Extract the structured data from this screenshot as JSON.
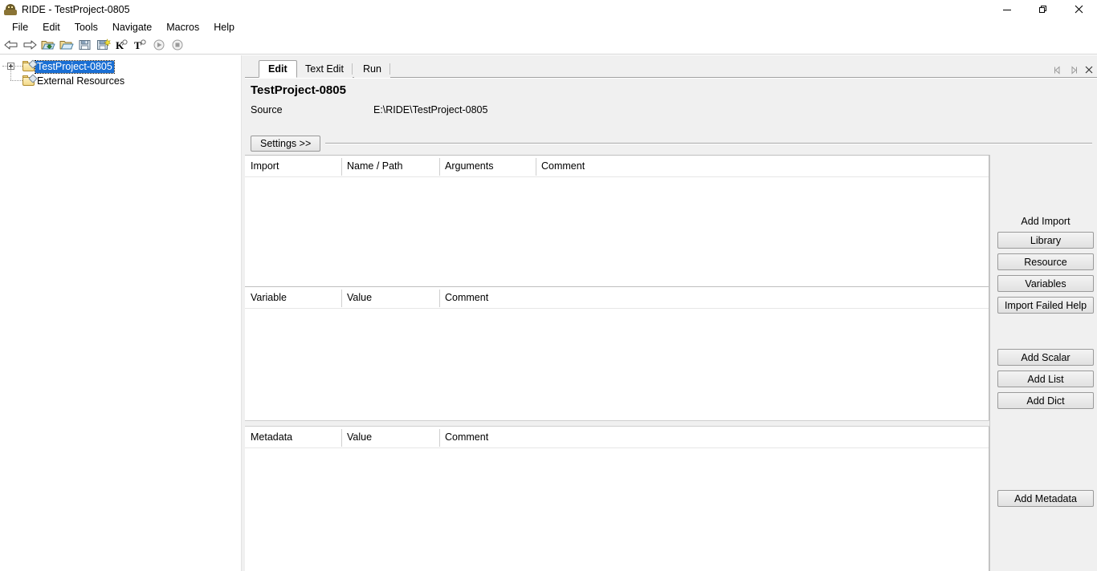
{
  "window": {
    "title": "RIDE - TestProject-0805",
    "app_icon": "robot-icon",
    "controls": [
      {
        "name": "minimize-button",
        "glyph": "minimize-icon"
      },
      {
        "name": "restore-button",
        "glyph": "restore-icon"
      },
      {
        "name": "close-button",
        "glyph": "close-icon"
      }
    ]
  },
  "menubar": {
    "items": [
      {
        "label": "File"
      },
      {
        "label": "Edit"
      },
      {
        "label": "Tools"
      },
      {
        "label": "Navigate"
      },
      {
        "label": "Macros"
      },
      {
        "label": "Help"
      }
    ]
  },
  "toolbar": {
    "items": [
      {
        "name": "back-arrow-icon",
        "title": "Back"
      },
      {
        "name": "forward-arrow-icon",
        "title": "Forward"
      },
      {
        "name": "open-directory-icon",
        "title": "Open Directory"
      },
      {
        "name": "open-file-icon",
        "title": "Open"
      },
      {
        "name": "save-icon",
        "title": "Save"
      },
      {
        "name": "save-all-icon",
        "title": "Save All"
      },
      {
        "name": "search-keyword-icon",
        "title": "Search Keywords",
        "letter": "K"
      },
      {
        "name": "search-tests-icon",
        "title": "Search Tests",
        "letter": "T"
      },
      {
        "name": "run-icon",
        "title": "Run"
      },
      {
        "name": "stop-icon",
        "title": "Stop"
      }
    ]
  },
  "tree": {
    "items": [
      {
        "label": "TestProject-0805",
        "selected": true,
        "expandable": true,
        "icon": "project-folder-icon"
      },
      {
        "label": "External Resources",
        "selected": false,
        "expandable": false,
        "icon": "folder-icon"
      }
    ]
  },
  "tabs": {
    "items": [
      {
        "label": "Edit",
        "active": true
      },
      {
        "label": "Text Edit",
        "active": false
      },
      {
        "label": "Run",
        "active": false
      }
    ],
    "nav": [
      {
        "name": "tab-prev-button",
        "glyph": "chevron-left-icon"
      },
      {
        "name": "tab-next-button",
        "glyph": "chevron-right-icon"
      },
      {
        "name": "tab-close-button",
        "glyph": "close-icon"
      }
    ]
  },
  "info": {
    "project_title": "TestProject-0805",
    "source_label": "Source",
    "source_value": "E:\\RIDE\\TestProject-0805"
  },
  "settings": {
    "button_label": "Settings >>"
  },
  "grids": {
    "import": {
      "headers": [
        "Import",
        "Name / Path",
        "Arguments",
        "Comment"
      ],
      "rows": []
    },
    "variable": {
      "headers": [
        "Variable",
        "Value",
        "Comment"
      ],
      "rows": []
    },
    "metadata": {
      "headers": [
        "Metadata",
        "Value",
        "Comment"
      ],
      "rows": []
    }
  },
  "side_panel": {
    "add_import_label": "Add Import",
    "import_buttons": [
      {
        "label": "Library"
      },
      {
        "label": "Resource"
      },
      {
        "label": "Variables"
      },
      {
        "label": "Import Failed Help"
      }
    ],
    "variable_buttons": [
      {
        "label": "Add Scalar"
      },
      {
        "label": "Add List"
      },
      {
        "label": "Add Dict"
      }
    ],
    "metadata_buttons": [
      {
        "label": "Add Metadata"
      }
    ]
  },
  "colors": {
    "selection_blue": "#1a6fd4",
    "panel_gray": "#f0f0f0",
    "grid_white": "#ffffff",
    "border_gray": "#bfbfbf"
  }
}
